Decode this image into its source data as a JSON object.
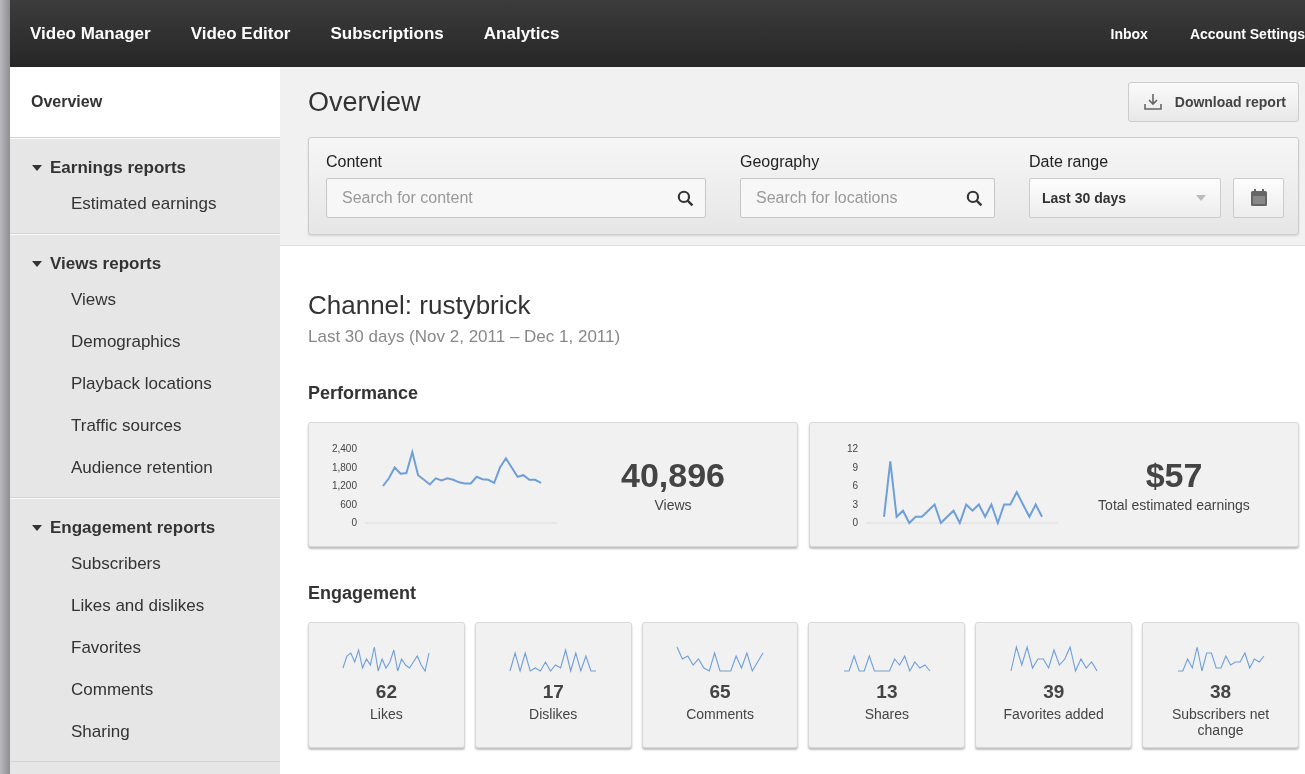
{
  "nav": {
    "left": [
      "Video Manager",
      "Video Editor",
      "Subscriptions",
      "Analytics"
    ],
    "right": [
      "Inbox",
      "Account Settings"
    ]
  },
  "sidebar": {
    "top": [
      {
        "label": "Overview",
        "selected": true
      }
    ],
    "groups": [
      {
        "label": "Earnings reports",
        "expanded": true,
        "items": [
          {
            "label": "Estimated earnings",
            "selected": false
          }
        ]
      },
      {
        "label": "Views reports",
        "expanded": true,
        "items": [
          {
            "label": "Views",
            "selected": false
          },
          {
            "label": "Demographics",
            "selected": false
          },
          {
            "label": "Playback locations",
            "selected": false
          },
          {
            "label": "Traffic sources",
            "selected": false
          },
          {
            "label": "Audience retention",
            "selected": false
          }
        ]
      },
      {
        "label": "Engagement reports",
        "expanded": true,
        "items": [
          {
            "label": "Subscribers",
            "selected": false
          },
          {
            "label": "Likes and dislikes",
            "selected": false
          },
          {
            "label": "Favorites",
            "selected": false
          },
          {
            "label": "Comments",
            "selected": false
          },
          {
            "label": "Sharing",
            "selected": false
          }
        ]
      }
    ]
  },
  "page_title": "Overview",
  "download_button": "Download report",
  "filters": {
    "content": {
      "label": "Content",
      "placeholder": "Search for content"
    },
    "geography": {
      "label": "Geography",
      "placeholder": "Search for locations"
    },
    "date_range": {
      "label": "Date range",
      "value": "Last 30 days"
    }
  },
  "channel_title": "Channel: rustybrick",
  "date_subtitle": "Last 30 days (Nov 2, 2011 – Dec 1, 2011)",
  "performance": {
    "heading": "Performance",
    "cards": [
      {
        "value": "40,896",
        "label": "Views",
        "chart_data": {
          "type": "line",
          "ylim": [
            0,
            2400
          ],
          "yticks": [
            0,
            600,
            {
              "value": 1200,
              "label": "1,200"
            },
            {
              "value": 1800,
              "label": "1,800"
            },
            {
              "value": 2400,
              "label": "2,400"
            }
          ],
          "series": [
            {
              "color": "#6f9fd8",
              "values": [
                1200,
                1450,
                1800,
                1600,
                1620,
                2300,
                1550,
                1400,
                1250,
                1450,
                1380,
                1450,
                1400,
                1320,
                1280,
                1280,
                1500,
                1420,
                1400,
                1300,
                1800,
                2100,
                1800,
                1500,
                1550,
                1400,
                1400,
                1300
              ]
            }
          ]
        }
      },
      {
        "value": "$57",
        "label": "Total estimated earnings",
        "chart_data": {
          "type": "line",
          "ylim": [
            0,
            12
          ],
          "yticks": [
            0,
            3,
            6,
            9,
            12
          ],
          "series": [
            {
              "color": "#6f9fd8",
              "values": [
                1,
                10,
                1,
                2,
                0,
                1,
                1,
                2,
                3,
                0,
                1,
                2,
                0,
                3,
                2,
                3,
                1,
                3,
                0,
                3,
                3,
                5,
                3,
                1,
                3,
                1
              ]
            }
          ]
        }
      }
    ]
  },
  "engagement": {
    "heading": "Engagement",
    "cards": [
      {
        "value": "62",
        "label": "Likes"
      },
      {
        "value": "17",
        "label": "Dislikes"
      },
      {
        "value": "65",
        "label": "Comments"
      },
      {
        "value": "13",
        "label": "Shares"
      },
      {
        "value": "39",
        "label": "Favorites added"
      },
      {
        "value": "38",
        "label": "Subscribers net change"
      }
    ]
  }
}
